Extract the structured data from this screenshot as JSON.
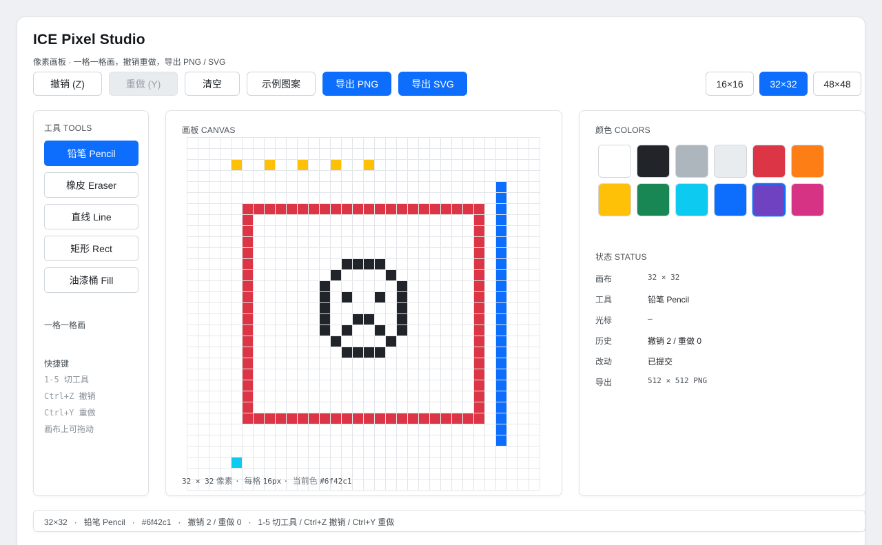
{
  "app": {
    "title": "ICE Pixel Studio",
    "subtitle": "像素画板 · 一格一格画，撤销重做，导出 PNG / SVG"
  },
  "toolbar": {
    "undo": "撤销 (Z)",
    "redo": "重做 (Y)",
    "clear": "清空",
    "sample": "示例图案",
    "export_png": "导出 PNG",
    "export_svg": "导出 SVG",
    "sizes": [
      "16×16",
      "32×32",
      "48×48"
    ],
    "selected_size": "32×32"
  },
  "tools": {
    "heading": "工具 TOOLS",
    "items": [
      "铅笔 Pencil",
      "橡皮 Eraser",
      "直线 Line",
      "矩形 Rect",
      "油漆桶 Fill"
    ],
    "active": "铅笔 Pencil",
    "note": "一格一格画",
    "shortcuts_heading": "快捷键",
    "shortcuts": [
      {
        "key": "1-5",
        "label": "切工具"
      },
      {
        "key": "Ctrl+Z",
        "label": "撤销"
      },
      {
        "key": "Ctrl+Y",
        "label": "重做"
      }
    ],
    "drag_hint": "画布上可拖动"
  },
  "canvas": {
    "heading": "画板 CANVAS",
    "footer": {
      "size": "32 × 32",
      "size_label": "像素",
      "cell_label": "每格",
      "cell": "16px",
      "color_label": "当前色",
      "color": "#6f42c1"
    },
    "grid_size": 32,
    "pixels": [
      {
        "color": "#ffc107",
        "cells": [
          [
            4,
            2
          ],
          [
            7,
            2
          ],
          [
            10,
            2
          ],
          [
            13,
            2
          ],
          [
            16,
            2
          ]
        ]
      },
      {
        "color": "#0dcaf0",
        "cells": [
          [
            4,
            29
          ]
        ]
      },
      {
        "color": "#0d6efd",
        "rect": [
          28,
          4,
          28,
          27
        ]
      },
      {
        "color": "#dc3545",
        "frame": [
          5,
          6,
          26,
          25
        ]
      },
      {
        "color": "#212529",
        "cells": [
          [
            14,
            11
          ],
          [
            15,
            11
          ],
          [
            16,
            11
          ],
          [
            17,
            11
          ],
          [
            13,
            12
          ],
          [
            18,
            12
          ],
          [
            12,
            13
          ],
          [
            19,
            13
          ],
          [
            12,
            14
          ],
          [
            14,
            14
          ],
          [
            17,
            14
          ],
          [
            19,
            14
          ],
          [
            12,
            15
          ],
          [
            19,
            15
          ],
          [
            12,
            16
          ],
          [
            15,
            16
          ],
          [
            16,
            16
          ],
          [
            19,
            16
          ],
          [
            12,
            17
          ],
          [
            14,
            17
          ],
          [
            17,
            17
          ],
          [
            19,
            17
          ],
          [
            13,
            18
          ],
          [
            18,
            18
          ],
          [
            14,
            19
          ],
          [
            15,
            19
          ],
          [
            16,
            19
          ],
          [
            17,
            19
          ]
        ]
      }
    ]
  },
  "colors": {
    "heading": "颜色 COLORS",
    "palette": [
      "#ffffff",
      "#212529",
      "#adb5bd",
      "#e9ecef",
      "#dc3545",
      "#fd7e14",
      "#ffc107",
      "#198754",
      "#0dcaf0",
      "#0d6efd",
      "#6f42c1",
      "#d63384"
    ],
    "selected": "#6f42c1"
  },
  "status": {
    "heading": "状态 STATUS",
    "rows": [
      {
        "key": "画布",
        "value": "32 × 32"
      },
      {
        "key": "工具",
        "value": "铅笔 Pencil"
      },
      {
        "key": "光标",
        "value": "—"
      },
      {
        "key": "历史",
        "value": "撤销 2 / 重做 0"
      },
      {
        "key": "改动",
        "value": "已提交"
      },
      {
        "key": "导出",
        "value": "512 × 512 PNG"
      }
    ]
  },
  "statusbar": {
    "text": "32×32   ·   铅笔 Pencil   ·   #6f42c1   ·   撤销 2 / 重做 0   ·   1-5 切工具 / Ctrl+Z 撤销 / Ctrl+Y 重做"
  }
}
